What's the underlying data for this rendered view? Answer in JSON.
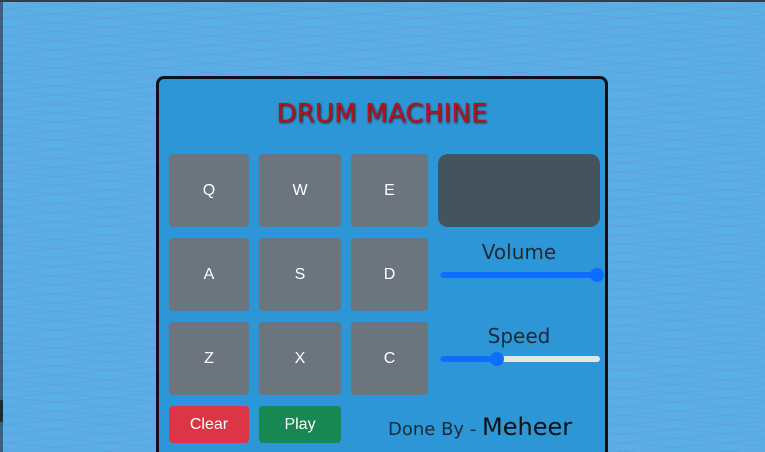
{
  "app": {
    "title": "DRUM MACHINE"
  },
  "pads": [
    {
      "key": "Q"
    },
    {
      "key": "W"
    },
    {
      "key": "E"
    },
    {
      "key": "A"
    },
    {
      "key": "S"
    },
    {
      "key": "D"
    },
    {
      "key": "Z"
    },
    {
      "key": "X"
    },
    {
      "key": "C"
    }
  ],
  "display": {
    "text": ""
  },
  "controls": {
    "volume_label": "Volume",
    "volume_value": 1.0,
    "speed_label": "Speed",
    "speed_value": 0.35
  },
  "buttons": {
    "clear_label": "Clear",
    "play_label": "Play"
  },
  "credit": {
    "prefix": "Done By -",
    "name": "Meheer"
  },
  "colors": {
    "page_bg": "#5aaee6",
    "machine_bg": "#2c96d6",
    "title": "#b3121f",
    "pad": "#6c757d",
    "display": "#44535e",
    "slider_accent": "#0d6efd",
    "clear": "#dc3545",
    "play": "#198754"
  }
}
